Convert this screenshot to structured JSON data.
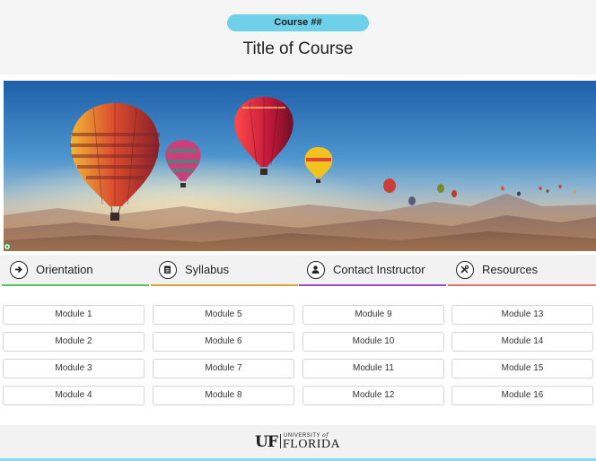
{
  "header": {
    "course_number": "Course  ##",
    "title": "Title of Course"
  },
  "colors": {
    "pill": "#6fd0ea",
    "orientation": "#5cc06a",
    "syllabus": "#e2a23a",
    "contact": "#9a4fc4",
    "resources": "#e0736a",
    "footer_line": "#8fd8ec"
  },
  "nav": [
    {
      "label": "Orientation",
      "icon": "arrow-circle-icon"
    },
    {
      "label": "Syllabus",
      "icon": "clipboard-icon"
    },
    {
      "label": "Contact Instructor",
      "icon": "user-icon"
    },
    {
      "label": "Resources",
      "icon": "tools-icon"
    }
  ],
  "modules": [
    [
      "Module 1",
      "Module 5",
      "Module 9",
      "Module 13"
    ],
    [
      "Module 2",
      "Module 6",
      "Module 10",
      "Module 14"
    ],
    [
      "Module 3",
      "Module 7",
      "Module 11",
      "Module 15"
    ],
    [
      "Module 4",
      "Module 8",
      "Module 12",
      "Module 16"
    ]
  ],
  "footer": {
    "logo_mark": "UF",
    "logo_university": "UNIVERSITY",
    "logo_of": "of",
    "logo_state": "FLORIDA"
  }
}
